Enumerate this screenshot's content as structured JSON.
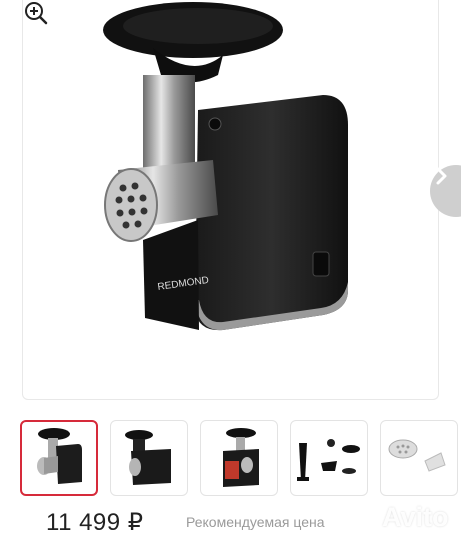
{
  "gallery": {
    "main_image_alt": "meat-grinder-photo",
    "brand_text": "REDMOND",
    "next_icon": "chevron-right-icon",
    "zoom_icon": "zoom-in-icon",
    "selected_thumbnail": 1,
    "thumbnails": [
      {
        "depicts": "meat-grinder-front"
      },
      {
        "depicts": "meat-grinder-side"
      },
      {
        "depicts": "meat-grinder-red-logo"
      },
      {
        "depicts": "accessories-pusher-and-parts"
      },
      {
        "depicts": "accessories-discs"
      }
    ]
  },
  "price": {
    "value": "11 499 ₽",
    "recommended_label": "Рекомендуемая цена"
  },
  "watermark": {
    "text": "Avito"
  },
  "colors": {
    "accent_selected": "#d62a3a",
    "price_text": "#222222",
    "secondary_text": "#9a9a9a",
    "nav_button": "#cfcfcf"
  }
}
